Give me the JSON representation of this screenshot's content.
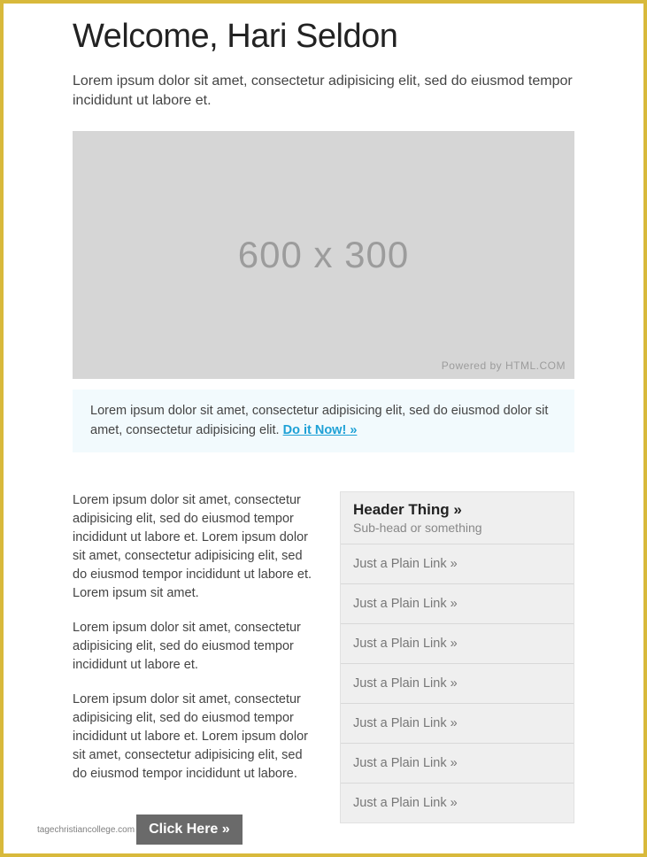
{
  "header": {
    "title": "Welcome, Hari Seldon",
    "intro": "Lorem ipsum dolor sit amet, consectetur adipisicing elit, sed do eiusmod tempor incididunt ut labore et."
  },
  "hero": {
    "placeholder_label": "600 x 300",
    "powered_by": "Powered by HTML.COM"
  },
  "callout": {
    "text": "Lorem ipsum dolor sit amet, consectetur adipisicing elit, sed do eiusmod dolor sit amet, consectetur adipisicing elit. ",
    "link_label": "Do it Now! »"
  },
  "body": {
    "paragraphs": [
      "Lorem ipsum dolor sit amet, consectetur adipisicing elit, sed do eiusmod tempor incididunt ut labore et. Lorem ipsum dolor sit amet, consectetur adipisicing elit, sed do eiusmod tempor incididunt ut labore et. Lorem ipsum sit amet.",
      "Lorem ipsum dolor sit amet, consectetur adipisicing elit, sed do eiusmod tempor incididunt ut labore et.",
      "Lorem ipsum dolor sit amet, consectetur adipisicing elit, sed do eiusmod tempor incididunt ut labore et. Lorem ipsum dolor sit amet, consectetur adipisicing elit, sed do eiusmod tempor incididunt ut labore."
    ]
  },
  "sidebar": {
    "title": "Header Thing »",
    "subtitle": "Sub-head or something",
    "items": [
      "Just a Plain Link »",
      "Just a Plain Link »",
      "Just a Plain Link »",
      "Just a Plain Link »",
      "Just a Plain Link »",
      "Just a Plain Link »",
      "Just a Plain Link »"
    ]
  },
  "footer": {
    "site_text": "tagechristiancollege.com",
    "button_label": "Click Here »"
  }
}
